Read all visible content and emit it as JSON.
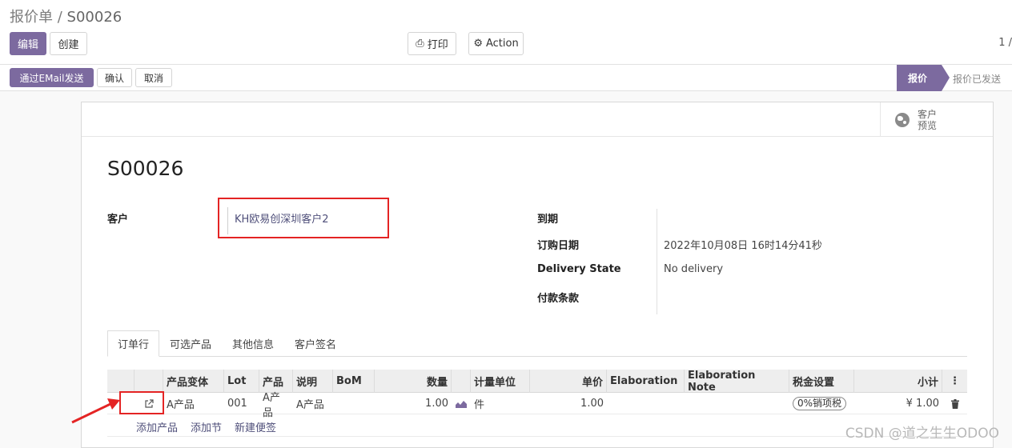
{
  "breadcrumb": {
    "parent": "报价单",
    "separator": "/",
    "current": "S00026"
  },
  "toolbar": {
    "edit": "编辑",
    "create": "创建",
    "print": "打印",
    "action": "Action",
    "pager": "1 /"
  },
  "statusbar": {
    "send_email": "通过EMail发送",
    "confirm": "确认",
    "cancel": "取消",
    "stage_active": "报价",
    "stage_next": "报价已发送"
  },
  "preview": {
    "line1": "客户",
    "line2": "预览"
  },
  "record": {
    "title": "S00026",
    "customer_label": "客户",
    "customer_value": "KH欧易创深圳客户2",
    "due_label": "到期",
    "order_date_label": "订购日期",
    "order_date_value": "2022年10月08日 16时14分41秒",
    "delivery_state_label": "Delivery State",
    "delivery_state_value": "No delivery",
    "payment_terms_label": "付款条款"
  },
  "tabs": [
    "订单行",
    "可选产品",
    "其他信息",
    "客户签名"
  ],
  "table": {
    "headers": [
      "产品变体",
      "Lot",
      "产品",
      "说明",
      "BoM",
      "数量",
      "计量单位",
      "单价",
      "Elaboration",
      "Elaboration Note",
      "税金设置",
      "小计"
    ],
    "rows": [
      {
        "variant": "A产品",
        "lot": "001",
        "product": "A产品",
        "description": "A产品",
        "bom": "",
        "qty": "1.00",
        "uom": "件",
        "price": "1.00",
        "elaboration": "",
        "elab_note": "",
        "tax": "0%销项税",
        "subtotal": "¥ 1.00"
      }
    ],
    "add_links": [
      "添加产品",
      "添加节",
      "新建便签"
    ]
  },
  "watermark": "CSDN @道之生生ODOO",
  "colors": {
    "primary": "#7c6a9f",
    "highlight": "#e42424"
  }
}
